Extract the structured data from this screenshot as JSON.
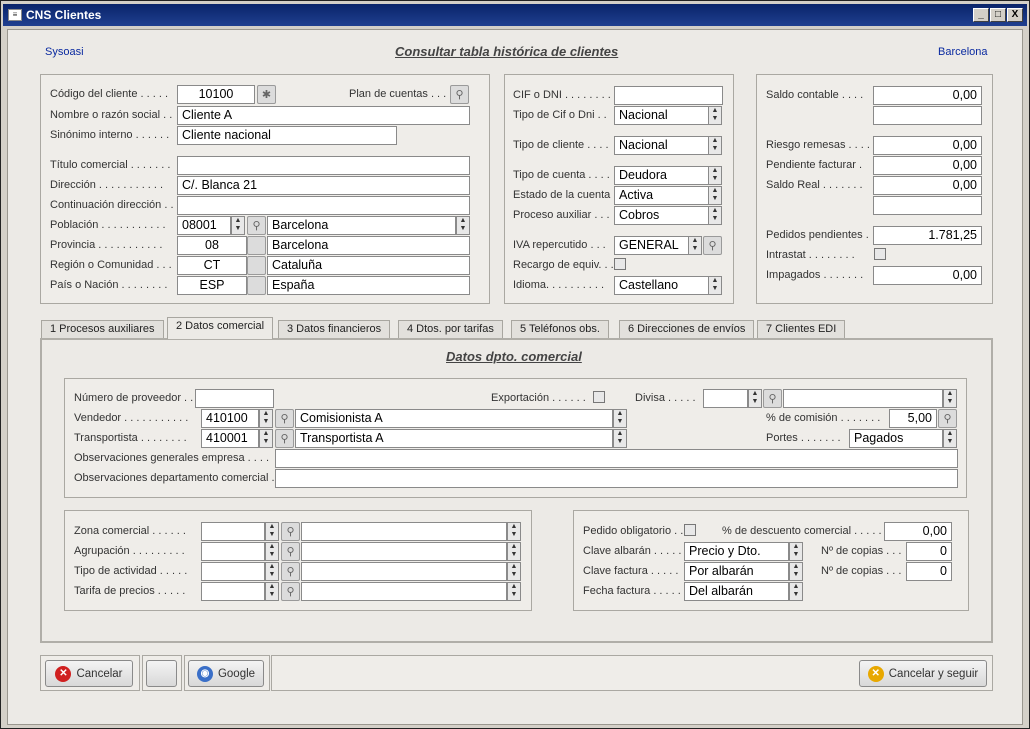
{
  "window": {
    "title": "CNS Clientes",
    "minimize": "_",
    "maximize": "□",
    "close": "X"
  },
  "header": {
    "left": "Sysoasi",
    "title": "Consultar tabla histórica de clientes",
    "right": "Barcelona"
  },
  "client": {
    "codigo_label": "Código del cliente . . . . .",
    "codigo": "10100",
    "plan_label": "Plan de cuentas . . .",
    "nombre_label": "Nombre o razón social . .",
    "nombre": "Cliente A",
    "sinonimo_label": "Sinónimo interno . . . . . .",
    "sinonimo": "Cliente nacional",
    "titulo_label": "Título comercial . . . . . . .",
    "titulo": "",
    "direccion_label": "Dirección . . . . . . . . . . .",
    "direccion": "C/. Blanca 21",
    "continuacion_label": "Continuación dirección . .",
    "continuacion": "",
    "poblacion_label": "Población . . . . . . . . . . .",
    "poblacion_code": "08001",
    "poblacion": "Barcelona",
    "provincia_label": "Provincia . . . . . . . . . . .",
    "provincia_code": "08",
    "provincia": "Barcelona",
    "region_label": "Región o Comunidad . . .",
    "region_code": "CT",
    "region": "Cataluña",
    "pais_label": "País o Nación . . . . . . . .",
    "pais_code": "ESP",
    "pais": "España"
  },
  "fiscal": {
    "cif_label": "CIF o DNI . . . . . . . .",
    "cif": "",
    "tipo_cif_label": "Tipo de Cif o Dni . .",
    "tipo_cif": "Nacional",
    "tipo_cliente_label": "Tipo de cliente . . . .",
    "tipo_cliente": "Nacional",
    "tipo_cuenta_label": "Tipo de cuenta . . . .",
    "tipo_cuenta": "Deudora",
    "estado_label": "Estado de la cuenta .",
    "estado": "Activa",
    "proceso_label": "Proceso auxiliar . . .",
    "proceso": "Cobros",
    "iva_label": "IVA repercutido . . .",
    "iva": "GENERAL",
    "recargo_label": "Recargo de equiv. . .",
    "idioma_label": "Idioma. . . . . . . . . .",
    "idioma": "Castellano"
  },
  "saldos": {
    "saldo_contable_label": "Saldo contable . . . .",
    "saldo_contable": "0,00",
    "riesgo_label": "Riesgo remesas . . . .",
    "riesgo": "0,00",
    "pendiente_label": "Pendiente facturar .",
    "pendiente": "0,00",
    "saldo_real_label": "Saldo Real . . . . . . .",
    "saldo_real": "0,00",
    "pedidos_label": "Pedidos pendientes .",
    "pedidos": "1.781,25",
    "intrastat_label": "Intrastat . . . . . . . .",
    "impagados_label": "Impagados . . . . . . .",
    "impagados": "0,00"
  },
  "tabs": [
    "1 Procesos auxiliares",
    "2 Datos comercial",
    "3 Datos financieros",
    "4 Dtos. por tarifas",
    "5 Teléfonos obs.",
    "6 Direcciones de envíos",
    "7 Clientes EDI"
  ],
  "comercial": {
    "title": "Datos dpto. comercial",
    "proveedor_label": "Número de proveedor . .",
    "proveedor": "",
    "exportacion_label": "Exportación . . . . . .",
    "divisa_label": "Divisa . . . . .",
    "divisa_code": "",
    "divisa": "",
    "vendedor_label": "Vendedor . . . . . . . . . . .",
    "vendedor_code": "410100",
    "vendedor": "Comisionista A",
    "comision_label": "% de comisión . . . . . . .",
    "comision": "5,00",
    "transportista_label": "Transportista . . . . . . . .",
    "transportista_code": "410001",
    "transportista": "Transportista A",
    "portes_label": "Portes . . . . . . .",
    "portes": "Pagados",
    "obs_empresa_label": "Observaciones generales empresa . . . .",
    "obs_empresa": "",
    "obs_dpto_label": "Observaciones departamento comercial .",
    "obs_dpto": "",
    "zona_label": "Zona comercial . . . . . .",
    "agrupacion_label": "Agrupación . . . . . . . . .",
    "actividad_label": "Tipo de actividad . . . . .",
    "tarifa_label": "Tarifa de precios . . . . .",
    "pedido_label": "Pedido obligatorio . .",
    "descuento_label": "% de descuento comercial . . . . .",
    "descuento": "0,00",
    "clave_albaran_label": "Clave albarán . . . . .",
    "clave_albaran": "Precio y Dto.",
    "copias1_label": "Nº de copias . . .",
    "copias1": "0",
    "clave_factura_label": "Clave factura . . . . .",
    "clave_factura": "Por albarán",
    "copias2_label": "Nº de copias . . .",
    "copias2": "0",
    "fecha_factura_label": "Fecha factura . . . . .",
    "fecha_factura": "Del albarán"
  },
  "footer": {
    "cancelar": "Cancelar",
    "google": "Google",
    "cancelar_seguir": "Cancelar y seguir"
  }
}
